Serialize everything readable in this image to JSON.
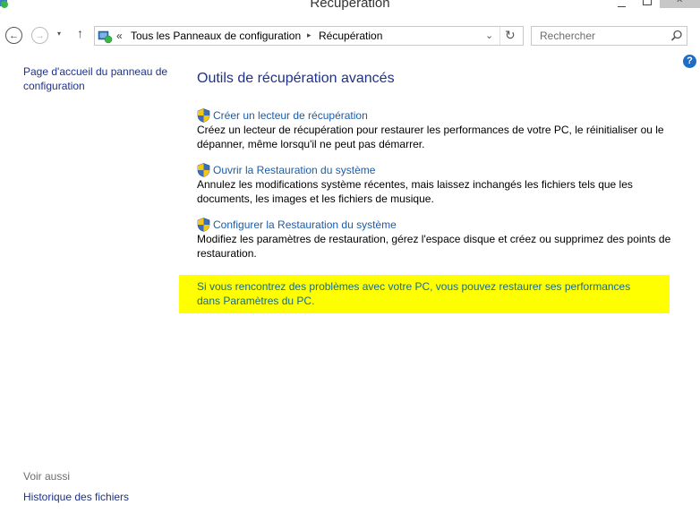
{
  "window": {
    "title": "Récupération"
  },
  "nav": {
    "back_glyph": "←",
    "forward_glyph": "→",
    "dropdown_glyph": "▾",
    "up_glyph": "↑"
  },
  "address": {
    "overflow": "«",
    "crumbs": [
      "Tous les Panneaux de configuration",
      "Récupération"
    ],
    "separator": "▸",
    "dropdown_glyph": "⌄",
    "refresh_glyph": "↻"
  },
  "search": {
    "placeholder": "Rechercher"
  },
  "help": {
    "glyph": "?"
  },
  "left_pane": {
    "home_link": "Page d'accueil du panneau de configuration",
    "see_also": "Voir aussi",
    "history_link": "Historique des fichiers"
  },
  "main": {
    "title": "Outils de récupération avancés",
    "items": [
      {
        "link": "Créer un lecteur de récupération",
        "description": "Créez un lecteur de récupération pour restaurer les performances de votre PC, le réinitialiser ou le dépanner, même lorsqu'il ne peut pas démarrer."
      },
      {
        "link": "Ouvrir la Restauration du système",
        "description": "Annulez les modifications système récentes, mais laissez inchangés les fichiers tels que les documents, les images et les fichiers de musique."
      },
      {
        "link": "Configurer la Restauration du système",
        "description": "Modifiez les paramètres de restauration, gérez l'espace disque et créez ou supprimez des points de restauration."
      }
    ],
    "info_text": "Si vous rencontrez des problèmes avec votre PC, vous pouvez restaurer ses performances dans Paramètres du PC."
  },
  "colors": {
    "link": "#1c5ca8",
    "title": "#1e3287",
    "highlight": "#ffff00",
    "info_text": "#1c6b7d"
  }
}
